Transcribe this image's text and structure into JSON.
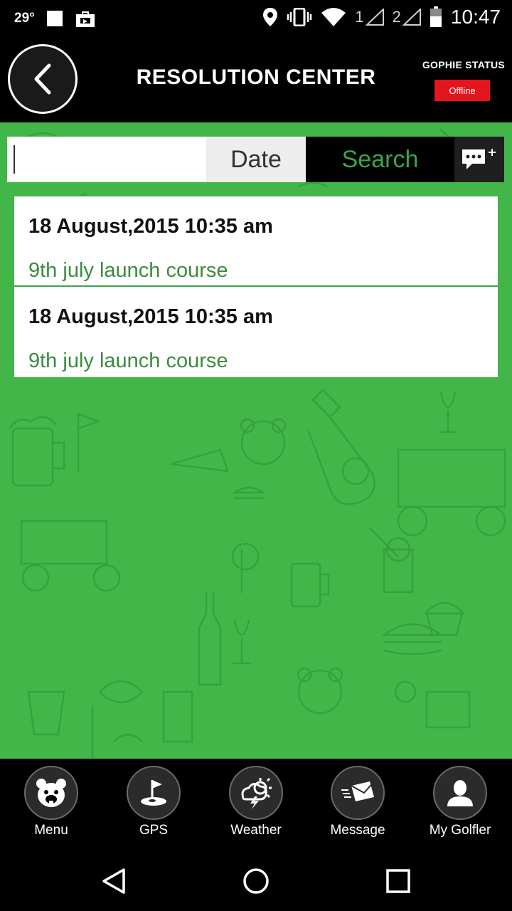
{
  "status_bar": {
    "temperature": "29°",
    "sim1": "1",
    "sim2": "2",
    "time": "10:47"
  },
  "header": {
    "title": "RESOLUTION CENTER",
    "status_label": "GOPHIE STATUS",
    "status_value": "Offline",
    "status_color": "#e3151f"
  },
  "search": {
    "input_value": "",
    "date_label": "Date",
    "search_label": "Search",
    "new_message_icon": "chat-plus-icon"
  },
  "items": [
    {
      "date": "18 August,2015 10:35 am",
      "course": "9th july launch course"
    },
    {
      "date": "18 August,2015 10:35 am",
      "course": "9th july launch course"
    }
  ],
  "nav": [
    {
      "label": "Menu",
      "icon": "bear-icon"
    },
    {
      "label": "GPS",
      "icon": "golf-flag-icon"
    },
    {
      "label": "Weather",
      "icon": "weather-storm-icon"
    },
    {
      "label": "Message",
      "icon": "envelope-icon"
    },
    {
      "label": "My Golfler",
      "icon": "user-icon"
    }
  ],
  "colors": {
    "background_green": "#43b649",
    "accent_green": "#3aa648",
    "course_text": "#3a8c3f"
  }
}
